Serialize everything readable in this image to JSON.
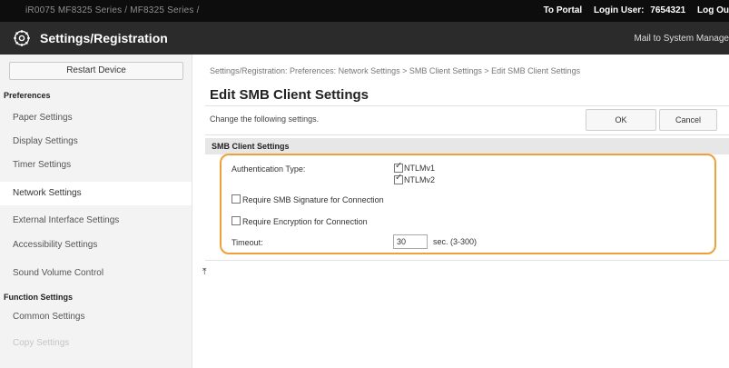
{
  "topbar": {
    "device_name": "iR0075  MF8325 Series / MF8325 Series /",
    "portal_link": "To Portal",
    "login_label": "Login User:",
    "login_user": "7654321",
    "logout_link": "Log Ou"
  },
  "header": {
    "title": "Settings/Registration",
    "mail_link": "Mail to System Manage"
  },
  "sidebar": {
    "restart_button": "Restart Device",
    "preferences_header": "Preferences",
    "preferences_items": [
      "Paper Settings",
      "Display Settings",
      "Timer Settings",
      "Network Settings",
      "External Interface Settings",
      "Accessibility Settings",
      "Sound Volume Control"
    ],
    "function_header": "Function Settings",
    "function_items": [
      "Common Settings",
      "Copy Settings"
    ],
    "active_item": "Network Settings"
  },
  "main": {
    "breadcrumb": "Settings/Registration: Preferences: Network Settings > SMB Client Settings > Edit SMB Client Settings",
    "page_title": "Edit SMB Client Settings",
    "instructions": "Change the following settings.",
    "ok_button": "OK",
    "cancel_button": "Cancel",
    "section_title": "SMB Client Settings",
    "auth_type_label": "Authentication Type:",
    "ntlmv1_label": "NTLMv1",
    "ntlmv1_checked": true,
    "ntlmv2_label": "NTLMv2",
    "ntlmv2_checked": true,
    "require_signature_label": "Require SMB Signature for Connection",
    "require_signature_checked": false,
    "require_encryption_label": "Require Encryption for Connection",
    "require_encryption_checked": false,
    "timeout_label": "Timeout:",
    "timeout_value": "30",
    "timeout_unit": "sec. (3-300)",
    "back_to_top_glyph": "⤒"
  },
  "colors": {
    "highlight_border": "#f0a03a",
    "header_bg": "#2b2b2b",
    "topbar_bg": "#0d0d0d"
  }
}
